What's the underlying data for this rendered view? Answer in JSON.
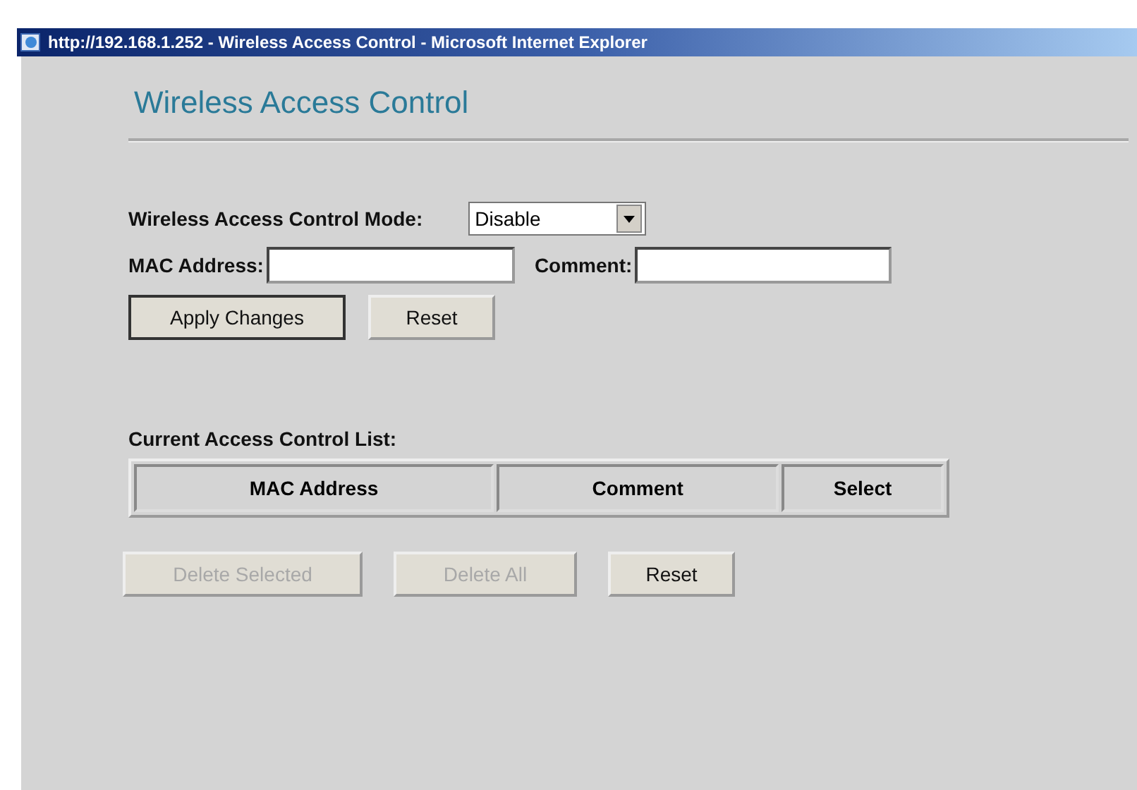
{
  "window": {
    "title": "http://192.168.1.252 - Wireless Access Control - Microsoft Internet Explorer"
  },
  "heading": "Wireless Access Control",
  "mode": {
    "label": "Wireless Access Control Mode:",
    "value": "Disable"
  },
  "mac_field": {
    "label": "MAC Address:"
  },
  "comment_field": {
    "label": "Comment:"
  },
  "form_buttons": [
    {
      "label": "Apply Changes",
      "disabled": false,
      "focused": true
    },
    {
      "label": "Reset",
      "disabled": false,
      "focused": false
    }
  ],
  "list": {
    "title": "Current Access Control List:",
    "columns": [
      "MAC Address",
      "Comment",
      "Select"
    ]
  },
  "list_buttons": [
    {
      "label": "Delete Selected",
      "disabled": true,
      "focused": false
    },
    {
      "label": "Delete All",
      "disabled": true,
      "focused": false
    },
    {
      "label": "Reset",
      "disabled": false,
      "focused": false
    }
  ]
}
